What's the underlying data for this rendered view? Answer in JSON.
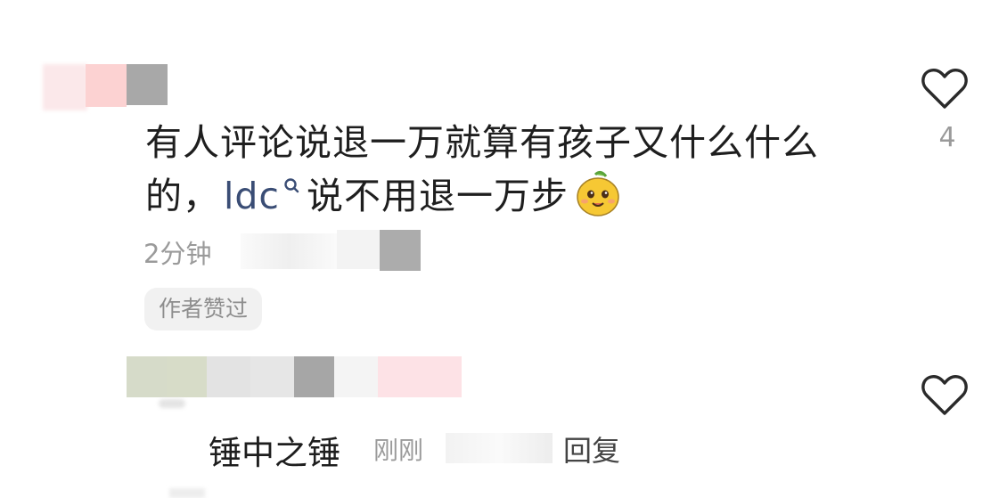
{
  "comment": {
    "text_before_mention": "有人评论说退一万就算有孩子又什么什么的，",
    "mention": "ldc",
    "text_after_mention": "说不用退一万步",
    "emoji": "yellow-mascot-emoji",
    "time": "2分钟",
    "author_liked_badge": "作者赞过",
    "like_count": "4"
  },
  "reply": {
    "text": "锤中之锤",
    "time": "刚刚",
    "reply_button": "回复"
  },
  "icons": {
    "like": "heart-outline-icon",
    "mention_search": "search-icon"
  },
  "colors": {
    "text": "#1e1e1e",
    "secondary": "#9a9a9a",
    "mention": "#3a4d75",
    "badge_bg": "#f1f1f1"
  }
}
